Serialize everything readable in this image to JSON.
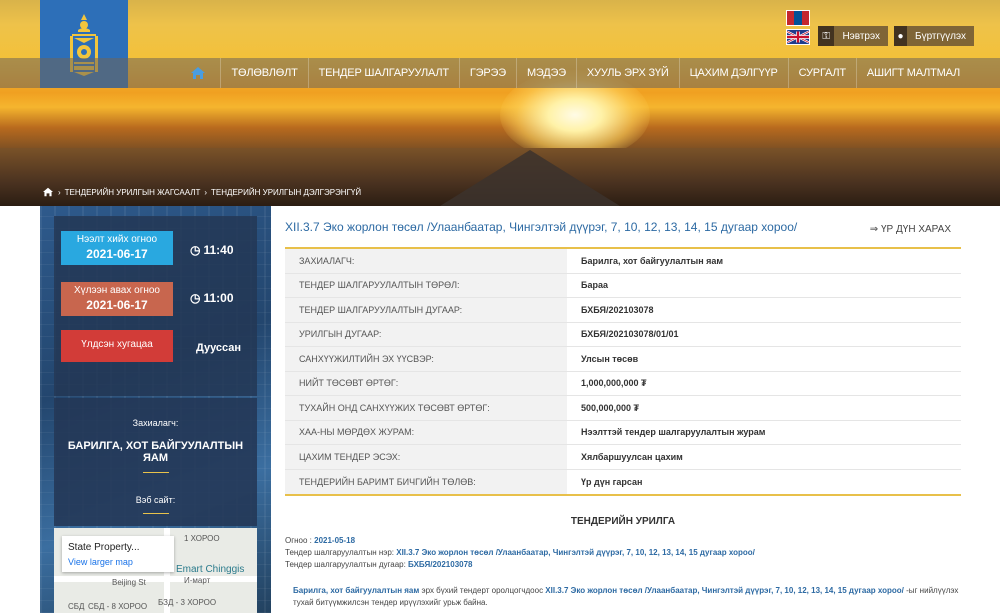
{
  "header": {
    "logo_icon": "soyombo-emblem-icon",
    "login_label": "Нэвтрэх",
    "register_label": "Бүртгүүлэх",
    "flags": [
      "mongolia-flag-icon",
      "uk-flag-icon"
    ]
  },
  "nav": {
    "home_icon": "home-icon",
    "items": [
      "ТӨЛӨВЛӨЛТ",
      "ТЕНДЕР ШАЛГАРУУЛАЛТ",
      "ГЭРЭЭ",
      "МЭДЭЭ",
      "ХУУЛЬ ЭРХ ЗҮЙ",
      "ЦАХИМ ДЭЛГҮҮР",
      "СУРГАЛТ",
      "АШИГТ МАЛТМАЛ"
    ]
  },
  "breadcrumb": {
    "items": [
      "ТЕНДЕРИЙН УРИЛГЫН ЖАГСААЛТ",
      "ТЕНДЕРИЙН УРИЛГЫН ДЭЛГЭРЭНГҮЙ"
    ]
  },
  "sidebar": {
    "open_label": "Нээлт хийх огноо",
    "open_date": "2021-06-17",
    "open_time": "11:40",
    "submit_label": "Хүлээн авах огноо",
    "submit_date": "2021-06-17",
    "submit_time": "11:00",
    "remaining_label": "Үлдсэн хугацаа",
    "remaining_value": "Дууссан",
    "customer_label": "Захиалагч:",
    "customer_name": "БАРИЛГА, ХОТ БАЙГУУЛАЛТЫН ЯАМ",
    "website_label": "Вэб сайт:",
    "map": {
      "card_title": "State Property...",
      "card_link": "View larger map",
      "labels": [
        "1 ХОРОО",
        "Emart Chinggis",
        "И-март",
        "Beijing St",
        "СБД - 8 ХОРОО",
        "БЗД - 3 ХОРОО",
        "СБД"
      ]
    }
  },
  "main": {
    "title": "XII.3.7 Эко жорлон төсөл /Улаанбаатар, Чингэлтэй дүүрэг, 7, 10, 12, 13, 14, 15 дугаар хороо/",
    "result_link": "ҮР ДҮН ХАРАХ",
    "rows": [
      {
        "k": "ЗАХИАЛАГЧ:",
        "v": "Барилга, хот байгуулалтын яам"
      },
      {
        "k": "ТЕНДЕР ШАЛГАРУУЛАЛТЫН ТӨРӨЛ:",
        "v": "Бараа"
      },
      {
        "k": "ТЕНДЕР ШАЛГАРУУЛАЛТЫН ДУГААР:",
        "v": "БХБЯ/202103078"
      },
      {
        "k": "УРИЛГЫН ДУГААР:",
        "v": "БХБЯ/202103078/01/01"
      },
      {
        "k": "САНХҮҮЖИЛТИЙН ЭХ ҮҮСВЭР:",
        "v": "Улсын төсөв"
      },
      {
        "k": "НИЙТ ТӨСӨВТ ӨРТӨГ:",
        "v": "1,000,000,000 ₮"
      },
      {
        "k": "ТУХАЙН ОНД САНХҮҮЖИХ ТӨСӨВТ ӨРТӨГ:",
        "v": "500,000,000 ₮"
      },
      {
        "k": "ХАА-НЫ МӨРДӨХ ЖУРАМ:",
        "v": "Нээлттэй тендер шалгаруулалтын журам"
      },
      {
        "k": "ЦАХИМ ТЕНДЕР ЭСЭХ:",
        "v": "Хялбаршуулсан цахим"
      },
      {
        "k": "ТЕНДЕРИЙН БАРИМТ БИЧГИЙН ТӨЛӨВ:",
        "v": "Үр дүн гарсан"
      }
    ],
    "section_title": "ТЕНДЕРИЙН УРИЛГА",
    "date_label": "Огноо : ",
    "date_value": "2021-05-18",
    "name_label": "Тендер шалгаруулалтын нэр: ",
    "name_value": "XII.3.7 Эко жорлон төсөл /Улаанбаатар, Чингэлтэй дүүрэг, 7, 10, 12, 13, 14, 15 дугаар хороо/",
    "number_label": "Тендер шалгаруулалтын дугаар: ",
    "number_value": "БХБЯ/202103078",
    "body_org": "Барилга, хот байгуулалтын яам",
    "body_mid": " эрх бүхий тендерт оролцогчдоос ",
    "body_proj": "XII.3.7 Эко жорлон төсөл /Улаанбаатар, Чингэлтэй дүүрэг, 7, 10, 12, 13, 14, 15 дугаар хороо/",
    "body_end": " -ыг нийлүүлэх тухай битүүмжилсэн тендер ирүүлэхийг урьж байна."
  }
}
